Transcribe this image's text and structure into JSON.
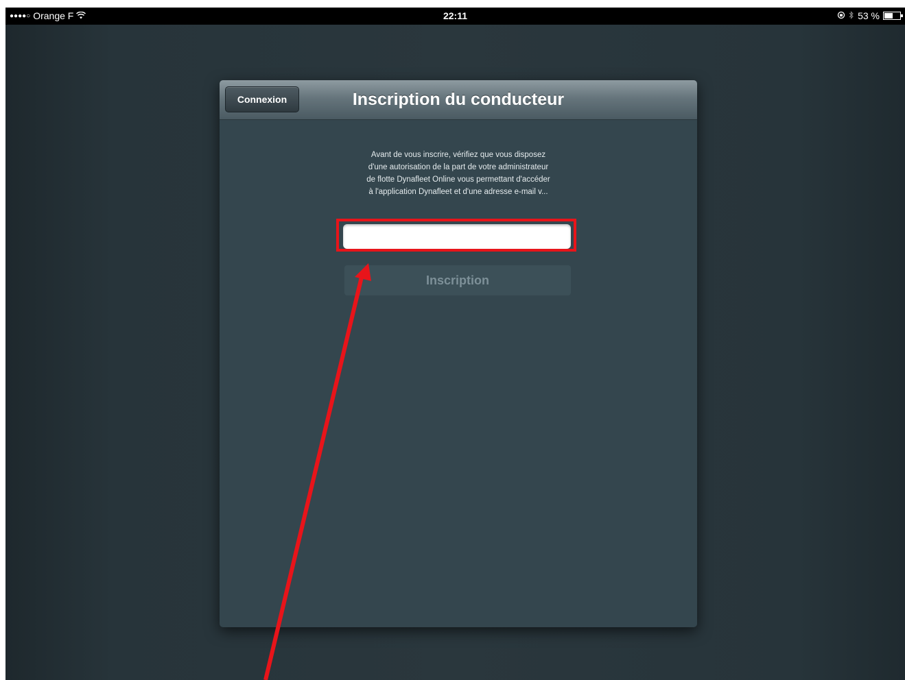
{
  "status_bar": {
    "signal": "●●●●○",
    "carrier": "Orange F",
    "wifi_icon": "wifi-icon",
    "time": "22:11",
    "battery_percent": "53 %",
    "battery_level": 0.53
  },
  "nav": {
    "back_label": "Connexion",
    "title": "Inscription du conducteur"
  },
  "info": {
    "lines": [
      "Avant de vous inscrire, vérifiez que vous disposez",
      "d'une autorisation de la part de votre administrateur",
      "de flotte Dynafleet Online vous permettant d'accéder",
      "à l'application Dynafleet et d'une adresse e-mail v..."
    ]
  },
  "form": {
    "email_value": "",
    "register_label": "Inscription"
  },
  "colors": {
    "annotation": "#e8141a",
    "modal_bg": "#34464e",
    "screen_bg": "#2a373d"
  }
}
